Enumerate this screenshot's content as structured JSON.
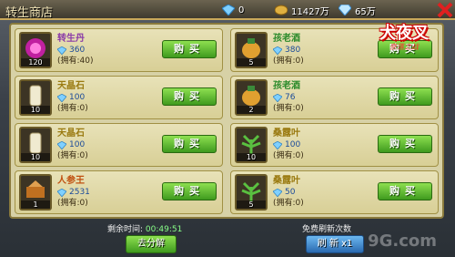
{
  "header": {
    "title": "转生商店",
    "crystal": "0",
    "gold": "11427万",
    "diamond": "65万"
  },
  "logo": {
    "main": "犬夜叉",
    "sub": "奈落之战"
  },
  "left_items": [
    {
      "name": "转生丹",
      "color": "p",
      "price": "360",
      "owned": "(拥有:40)",
      "count": "120",
      "buy": "购买",
      "icon": "pill-icon"
    },
    {
      "name": "天晶石",
      "color": "y",
      "price": "100",
      "owned": "(拥有:0)",
      "count": "10",
      "buy": "购买",
      "icon": "scroll-icon"
    },
    {
      "name": "天晶石",
      "color": "y",
      "price": "100",
      "owned": "(拥有:0)",
      "count": "10",
      "buy": "购买",
      "icon": "scroll-icon"
    },
    {
      "name": "人参王",
      "color": "o",
      "price": "2531",
      "owned": "(拥有:0)",
      "count": "1",
      "buy": "购买",
      "icon": "ginseng-icon"
    }
  ],
  "right_items": [
    {
      "name": "孩老酒",
      "color": "g",
      "price": "380",
      "owned": "(拥有:0)",
      "count": "5",
      "buy": "购买",
      "icon": "wine-jar-icon"
    },
    {
      "name": "孩老酒",
      "color": "g",
      "price": "76",
      "owned": "(拥有:0)",
      "count": "2",
      "buy": "购买",
      "icon": "wine-jar-icon"
    },
    {
      "name": "桑露叶",
      "color": "y",
      "price": "100",
      "owned": "(拥有:0)",
      "count": "10",
      "buy": "购买",
      "icon": "herb-icon"
    },
    {
      "name": "桑露叶",
      "color": "y",
      "price": "50",
      "owned": "(拥有:0)",
      "count": "5",
      "buy": "购买",
      "icon": "herb-icon"
    }
  ],
  "footer": {
    "timer_label": "剩余时间:",
    "timer_value": "00:49:51",
    "decompose": "去分解",
    "free_refresh": "免费刷新次数",
    "refresh": "刷 新 x1"
  },
  "watermark": "9G.com"
}
